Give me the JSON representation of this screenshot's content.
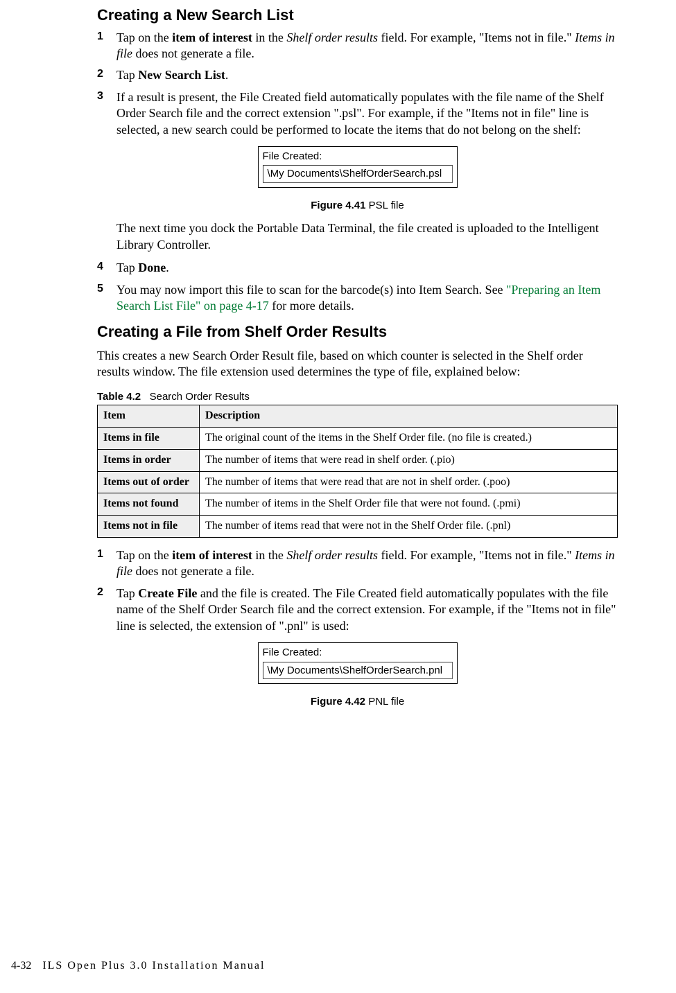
{
  "section1": {
    "title": "Creating a New Search List",
    "step1_num": "1",
    "step1_a": "Tap on the ",
    "step1_b": "item of interest",
    "step1_c": " in the ",
    "step1_d": "Shelf order results",
    "step1_e": " field. For example, \"Items not in file.\" ",
    "step1_f": "Items in file",
    "step1_g": " does not generate a file.",
    "step2_num": "2",
    "step2_a": "Tap ",
    "step2_b": "New Search List",
    "step2_c": ".",
    "step3_num": "3",
    "step3": "If a result is present, the File Created field automatically populates with the file name of the Shelf Order Search file and the correct extension \".psl\". For example, if the \"Items not in file\" line is selected, a new search could be performed to locate the items that do not belong on the shelf:",
    "fig1_label": "File Created:",
    "fig1_value": "\\My Documents\\ShelfOrderSearch.psl",
    "fig1_cap_bold": "Figure 4.41 ",
    "fig1_cap_text": "PSL file",
    "after_fig1": "The next time you dock the Portable Data Terminal, the file created is uploaded to the Intelligent Library Controller.",
    "step4_num": "4",
    "step4_a": "Tap ",
    "step4_b": "Done",
    "step4_c": ".",
    "step5_num": "5",
    "step5_a": "You may now import this file to scan for the barcode(s) into Item Search. See ",
    "step5_link": "\"Preparing an Item Search List File\" on page 4-17",
    "step5_b": " for more details."
  },
  "section2": {
    "title": "Creating a File from Shelf Order Results",
    "intro": "This creates a new Search Order Result file, based on which counter is selected in the Shelf order results window. The file extension used determines the type of file, explained below:",
    "table_label": "Table 4.2",
    "table_title": "Search Order Results",
    "table_header_item": "Item",
    "table_header_desc": "Description",
    "rows": [
      {
        "item": "Items in file",
        "desc": "The original count of the items in the Shelf Order file. (no file is created.)"
      },
      {
        "item": "Items in order",
        "desc": "The number of items that were read in shelf order. (.pio)"
      },
      {
        "item": "Items out of order",
        "desc": "The number of items that were read that are not in shelf order. (.poo)"
      },
      {
        "item": "Items not found",
        "desc": "The number of items in the Shelf Order file that were not found. (.pmi)"
      },
      {
        "item": "Items not in file",
        "desc": "The number of items read that were not in the Shelf Order file. (.pnl)"
      }
    ],
    "step1_num": "1",
    "step1_a": "Tap on the ",
    "step1_b": "item of interest",
    "step1_c": " in the ",
    "step1_d": "Shelf order results",
    "step1_e": " field. For example, \"Items not in file.\" ",
    "step1_f": "Items in file",
    "step1_g": " does not generate a file.",
    "step2_num": "2",
    "step2_a": "Tap ",
    "step2_b": "Create File",
    "step2_c": " and the file is created. The File Created field automatically populates with the file name of the Shelf Order Search file and the correct extension. For example, if the \"Items not in file\" line is selected, the extension of \".pnl\" is used:",
    "fig2_label": "File Created:",
    "fig2_value": "\\My Documents\\ShelfOrderSearch.pnl",
    "fig2_cap_bold": "Figure 4.42 ",
    "fig2_cap_text": "PNL file"
  },
  "footer": {
    "pagenum": "4-32",
    "title": "ILS Open Plus 3.0 Installation Manual"
  }
}
